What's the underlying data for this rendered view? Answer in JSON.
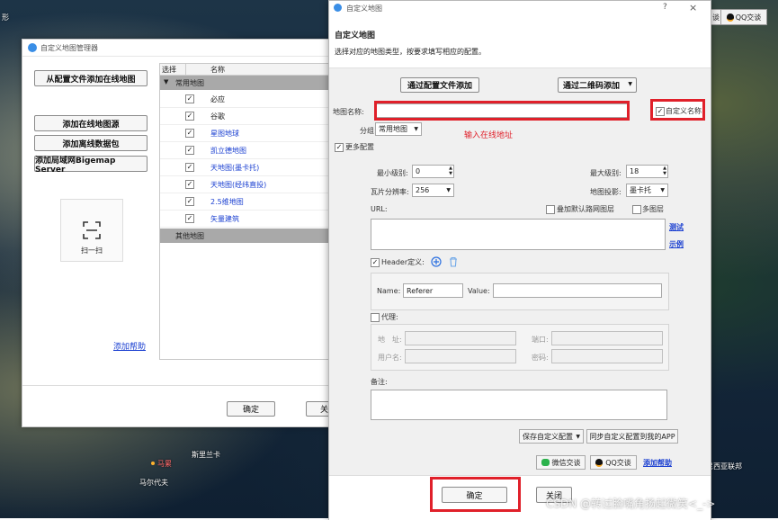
{
  "map": {
    "labels": [
      {
        "text": "斯里兰卡",
        "red": false
      },
      {
        "text": "马尔代夫",
        "red": false
      },
      {
        "text": "马累",
        "red": true
      },
      {
        "text": "形",
        "red": false
      },
      {
        "text": "尼西亚联邦",
        "red": false
      }
    ],
    "topbar": {
      "chat_label": "谈",
      "qq_label": "QQ交谈"
    }
  },
  "manager": {
    "title": "自定义地图管理器",
    "buttons": {
      "add_from_config": "从配置文件添加在线地图",
      "add_online_source": "添加在线地图源",
      "add_offline_pack": "添加离线数据包",
      "add_lan_server": "添加局域网Bigemap Server"
    },
    "scan_label": "扫一扫",
    "help_link": "添加帮助",
    "table": {
      "col_select": "选择",
      "col_name": "名称",
      "group_common": "常用地图",
      "group_other": "其他地图",
      "rows": [
        {
          "name": "必应",
          "link": false
        },
        {
          "name": "谷歌",
          "link": false
        },
        {
          "name": "星图地球",
          "link": true
        },
        {
          "name": "凯立德地图",
          "link": true
        },
        {
          "name": "天地图(墨卡托)",
          "link": true
        },
        {
          "name": "天地图(经纬直投)",
          "link": true
        },
        {
          "name": "2.5维地图",
          "link": true
        },
        {
          "name": "矢量建筑",
          "link": true
        }
      ]
    },
    "ok_label": "确定",
    "close_partial": "关"
  },
  "dialog": {
    "title": "自定义地图",
    "help_q": "?",
    "close_x": "×",
    "heading": "自定义地图",
    "desc": "选择对应的地图类型，按要求填写相应的配置。",
    "add_by_config": "通过配置文件添加",
    "add_by_qrcode": "通过二维码添加",
    "name_label": "地图名称:",
    "name_value": "",
    "custom_name_label": "自定义名称",
    "hint": "输入在线地址",
    "group_label": "分组:",
    "group_value": "常用地图",
    "more_config": "更多配置",
    "min_level_label": "最小级别:",
    "min_level_value": "0",
    "max_level_label": "最大级别:",
    "max_level_value": "18",
    "tile_res_label": "瓦片分辨率:",
    "tile_res_value": "256",
    "projection_label": "地图投影:",
    "projection_value": "墨卡托",
    "url_label": "URL:",
    "overlay_label": "叠加默认路网图层",
    "multi_layer_label": "多图层",
    "test_link": "测试",
    "example_link": "示例",
    "header_label": "Header定义:",
    "header_name_label": "Name:",
    "header_name_value": "Referer",
    "header_value_label": "Value:",
    "header_value_value": "",
    "proxy_label": "代理:",
    "addr_label": "地　址:",
    "port_label": "端口:",
    "user_label": "用户名:",
    "pass_label": "密码:",
    "note_label": "备注:",
    "save_config": "保存自定义配置",
    "sync_config": "同步自定义配置到我的APP",
    "wechat_chat": "微信交谈",
    "qq_chat": "QQ交谈",
    "help_link": "添加帮助",
    "ok_label": "确定",
    "close_label": "关闭"
  },
  "watermark": "CSDN @转过脸嘴角扬起微笑<_->",
  "colors": {
    "highlight_red": "#e0202a",
    "link_blue": "#1a3fd1",
    "group_gray": "#a9a9a9"
  }
}
